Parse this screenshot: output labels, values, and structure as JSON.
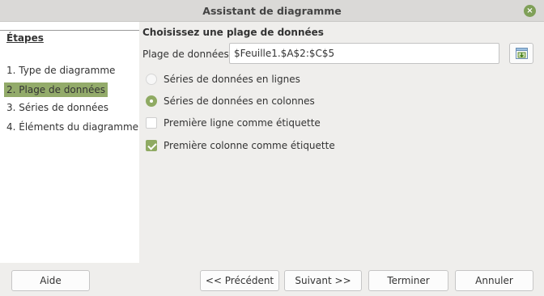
{
  "window": {
    "title": "Assistant de diagramme",
    "close_glyph": "×"
  },
  "sidebar": {
    "heading": "Étapes",
    "steps": [
      {
        "label": "1. Type de diagramme",
        "active": false
      },
      {
        "label": "2. Plage de données",
        "active": true
      },
      {
        "label": "3. Séries de données",
        "active": false
      },
      {
        "label": "4. Éléments du diagramme",
        "active": false
      }
    ]
  },
  "main": {
    "section_title": "Choisissez une plage de données",
    "range_label": "Plage de données :",
    "range_value": "$Feuille1.$A$2:$C$5",
    "range_button_icon": "shrink-range-icon",
    "options": [
      {
        "type": "radio",
        "label": "Séries de données en lignes",
        "checked": false
      },
      {
        "type": "radio",
        "label": "Séries de données en colonnes",
        "checked": true
      },
      {
        "type": "checkbox",
        "label": "Première ligne comme étiquette",
        "checked": false
      },
      {
        "type": "checkbox",
        "label": "Première colonne comme étiquette",
        "checked": true
      }
    ]
  },
  "footer": {
    "help": "Aide",
    "previous": "<< Précédent",
    "next": "Suivant >>",
    "finish": "Terminer",
    "cancel": "Annuler"
  },
  "colors": {
    "accent": "#8faa63",
    "active_step": "#93ab6a",
    "background": "#efeeec"
  }
}
